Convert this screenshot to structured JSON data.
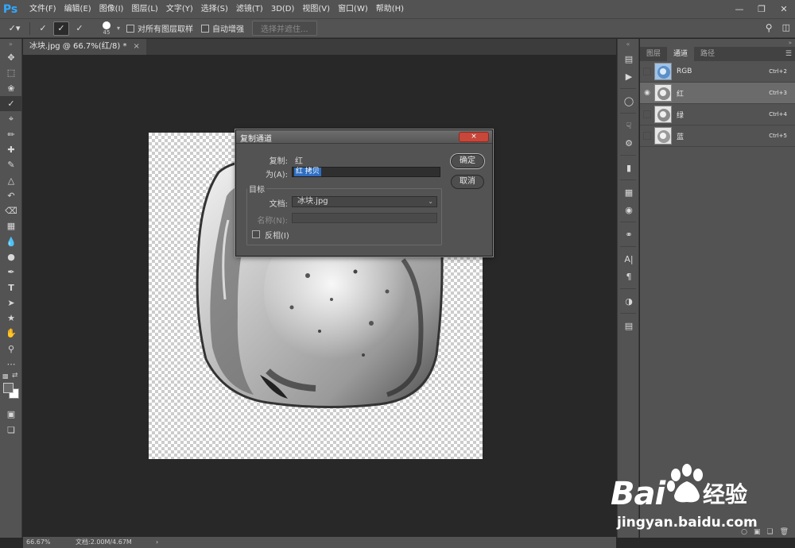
{
  "app": {
    "logo": "Ps",
    "menu": [
      "文件(F)",
      "编辑(E)",
      "图像(I)",
      "图层(L)",
      "文字(Y)",
      "选择(S)",
      "滤镜(T)",
      "3D(D)",
      "视图(V)",
      "窗口(W)",
      "帮助(H)"
    ],
    "window_controls": [
      "minimize-icon",
      "restore-icon",
      "close-icon"
    ]
  },
  "options_bar": {
    "brush_size": "45",
    "sample_all_layers_label": "对所有图层取样",
    "auto_enhance_label": "自动增强",
    "refine_edge_label": "选择并遮住..."
  },
  "document": {
    "tab_title": "冰块.jpg @ 66.7%(红/8) *",
    "tab_close": "×"
  },
  "status": {
    "zoom": "66.67%",
    "doc_size": "文档:2.00M/4.67M",
    "arrow": "›"
  },
  "channels_panel": {
    "tabs": [
      "图层",
      "通道",
      "路径"
    ],
    "active_tab": 1,
    "channels": [
      {
        "name": "RGB",
        "shortcut": "Ctrl+2",
        "visible": false,
        "selected": false
      },
      {
        "name": "红",
        "shortcut": "Ctrl+3",
        "visible": true,
        "selected": true
      },
      {
        "name": "绿",
        "shortcut": "Ctrl+4",
        "visible": false,
        "selected": false
      },
      {
        "name": "蓝",
        "shortcut": "Ctrl+5",
        "visible": false,
        "selected": false
      }
    ]
  },
  "dialog": {
    "title": "复制通道",
    "close": "×",
    "duplicate_label": "复制:",
    "duplicate_value": "红",
    "as_label": "为(A):",
    "as_value": "红 拷贝",
    "ok_label": "确定",
    "cancel_label": "取消",
    "destination_legend": "目标",
    "document_label": "文档:",
    "document_value": "冰块.jpg",
    "name_label": "名称(N):",
    "name_value": "",
    "invert_label": "反相(I)",
    "invert_checked": false
  },
  "watermark": {
    "brand_latin": "Bai",
    "brand_cn": "经验",
    "url": "jingyan.baidu.com"
  },
  "colors": {
    "ps_blue": "#31a8ff",
    "selection_blue": "#2e6ec0",
    "close_red": "#c7473a"
  }
}
